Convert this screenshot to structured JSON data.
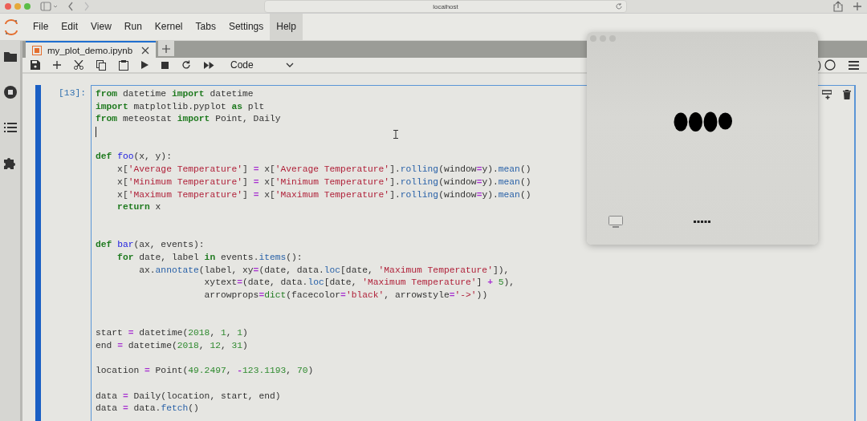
{
  "browser": {
    "address": "localhost"
  },
  "menu": [
    {
      "label": "File",
      "selected": false
    },
    {
      "label": "Edit",
      "selected": false
    },
    {
      "label": "View",
      "selected": false
    },
    {
      "label": "Run",
      "selected": false
    },
    {
      "label": "Kernel",
      "selected": false
    },
    {
      "label": "Tabs",
      "selected": false
    },
    {
      "label": "Settings",
      "selected": false
    },
    {
      "label": "Help",
      "selected": true
    }
  ],
  "tabs": [
    {
      "label": "my_plot_demo.ipynb",
      "selected": true
    }
  ],
  "toolbar": {
    "cell_type": "Code",
    "kernel_status": ")"
  },
  "cell": {
    "prompt": "[13]:",
    "lines": [
      {
        "cursor": false,
        "tokens": [
          {
            "kind": "kw",
            "text": "from"
          },
          {
            "kind": "plain",
            "text": " datetime "
          },
          {
            "kind": "kw",
            "text": "import"
          },
          {
            "kind": "plain",
            "text": " datetime"
          }
        ]
      },
      {
        "cursor": false,
        "tokens": [
          {
            "kind": "kw",
            "text": "import"
          },
          {
            "kind": "plain",
            "text": " matplotlib.pyplot "
          },
          {
            "kind": "kw",
            "text": "as"
          },
          {
            "kind": "plain",
            "text": " plt"
          }
        ]
      },
      {
        "cursor": false,
        "tokens": [
          {
            "kind": "kw",
            "text": "from"
          },
          {
            "kind": "plain",
            "text": " meteostat "
          },
          {
            "kind": "kw",
            "text": "import"
          },
          {
            "kind": "plain",
            "text": " Point, Daily"
          }
        ]
      },
      {
        "cursor": true
      },
      {
        "kind": "blank"
      },
      {
        "cursor": false,
        "tokens": [
          {
            "kind": "kw",
            "text": "def "
          },
          {
            "kind": "def",
            "text": "foo"
          },
          {
            "kind": "plain",
            "text": "(x, y):"
          }
        ]
      },
      {
        "cursor": false,
        "tokens": [
          {
            "kind": "plain",
            "text": "    x["
          },
          {
            "kind": "str",
            "text": "'Average Temperature'"
          },
          {
            "kind": "plain",
            "text": "] "
          },
          {
            "kind": "op",
            "text": "="
          },
          {
            "kind": "plain",
            "text": " x["
          },
          {
            "kind": "str",
            "text": "'Average Temperature'"
          },
          {
            "kind": "plain",
            "text": "]."
          },
          {
            "kind": "prop",
            "text": "rolling"
          },
          {
            "kind": "plain",
            "text": "(window"
          },
          {
            "kind": "op",
            "text": "="
          },
          {
            "kind": "plain",
            "text": "y)."
          },
          {
            "kind": "prop",
            "text": "mean"
          },
          {
            "kind": "plain",
            "text": "()"
          }
        ]
      },
      {
        "cursor": false,
        "tokens": [
          {
            "kind": "plain",
            "text": "    x["
          },
          {
            "kind": "str",
            "text": "'Minimum Temperature'"
          },
          {
            "kind": "plain",
            "text": "] "
          },
          {
            "kind": "op",
            "text": "="
          },
          {
            "kind": "plain",
            "text": " x["
          },
          {
            "kind": "str",
            "text": "'Minimum Temperature'"
          },
          {
            "kind": "plain",
            "text": "]."
          },
          {
            "kind": "prop",
            "text": "rolling"
          },
          {
            "kind": "plain",
            "text": "(window"
          },
          {
            "kind": "op",
            "text": "="
          },
          {
            "kind": "plain",
            "text": "y)."
          },
          {
            "kind": "prop",
            "text": "mean"
          },
          {
            "kind": "plain",
            "text": "()"
          }
        ]
      },
      {
        "cursor": false,
        "tokens": [
          {
            "kind": "plain",
            "text": "    x["
          },
          {
            "kind": "str",
            "text": "'Maximum Temperature'"
          },
          {
            "kind": "plain",
            "text": "] "
          },
          {
            "kind": "op",
            "text": "="
          },
          {
            "kind": "plain",
            "text": " x["
          },
          {
            "kind": "str",
            "text": "'Maximum Temperature'"
          },
          {
            "kind": "plain",
            "text": "]."
          },
          {
            "kind": "prop",
            "text": "rolling"
          },
          {
            "kind": "plain",
            "text": "(window"
          },
          {
            "kind": "op",
            "text": "="
          },
          {
            "kind": "plain",
            "text": "y)."
          },
          {
            "kind": "prop",
            "text": "mean"
          },
          {
            "kind": "plain",
            "text": "()"
          }
        ]
      },
      {
        "cursor": false,
        "tokens": [
          {
            "kind": "kw",
            "text": "    return"
          },
          {
            "kind": "plain",
            "text": " x"
          }
        ]
      },
      {
        "kind": "blank"
      },
      {
        "kind": "blank"
      },
      {
        "cursor": false,
        "tokens": [
          {
            "kind": "kw",
            "text": "def "
          },
          {
            "kind": "def",
            "text": "bar"
          },
          {
            "kind": "plain",
            "text": "(ax, events):"
          }
        ]
      },
      {
        "cursor": false,
        "tokens": [
          {
            "kind": "kw",
            "text": "    for"
          },
          {
            "kind": "plain",
            "text": " date, label "
          },
          {
            "kind": "kw",
            "text": "in"
          },
          {
            "kind": "plain",
            "text": " events."
          },
          {
            "kind": "prop",
            "text": "items"
          },
          {
            "kind": "plain",
            "text": "():"
          }
        ]
      },
      {
        "cursor": false,
        "tokens": [
          {
            "kind": "plain",
            "text": "        ax."
          },
          {
            "kind": "prop",
            "text": "annotate"
          },
          {
            "kind": "plain",
            "text": "(label, xy"
          },
          {
            "kind": "op",
            "text": "="
          },
          {
            "kind": "plain",
            "text": "(date, data."
          },
          {
            "kind": "prop",
            "text": "loc"
          },
          {
            "kind": "plain",
            "text": "[date, "
          },
          {
            "kind": "str",
            "text": "'Maximum Temperature'"
          },
          {
            "kind": "plain",
            "text": "]),"
          }
        ]
      },
      {
        "cursor": false,
        "tokens": [
          {
            "kind": "plain",
            "text": "                    xytext"
          },
          {
            "kind": "op",
            "text": "="
          },
          {
            "kind": "plain",
            "text": "(date, data."
          },
          {
            "kind": "prop",
            "text": "loc"
          },
          {
            "kind": "plain",
            "text": "[date, "
          },
          {
            "kind": "str",
            "text": "'Maximum Temperature'"
          },
          {
            "kind": "plain",
            "text": "] "
          },
          {
            "kind": "op",
            "text": "+"
          },
          {
            "kind": "num",
            "text": " 5"
          },
          {
            "kind": "plain",
            "text": "),"
          }
        ]
      },
      {
        "cursor": false,
        "tokens": [
          {
            "kind": "plain",
            "text": "                    arrowprops"
          },
          {
            "kind": "op",
            "text": "="
          },
          {
            "kind": "builtin",
            "text": "dict"
          },
          {
            "kind": "plain",
            "text": "(facecolor"
          },
          {
            "kind": "op",
            "text": "="
          },
          {
            "kind": "str",
            "text": "'black'"
          },
          {
            "kind": "plain",
            "text": ", arrowstyle"
          },
          {
            "kind": "op",
            "text": "="
          },
          {
            "kind": "str",
            "text": "'->'"
          },
          {
            "kind": "plain",
            "text": "))"
          }
        ]
      },
      {
        "kind": "blank"
      },
      {
        "kind": "blank"
      },
      {
        "cursor": false,
        "tokens": [
          {
            "kind": "plain",
            "text": "start "
          },
          {
            "kind": "op",
            "text": "="
          },
          {
            "kind": "plain",
            "text": " datetime("
          },
          {
            "kind": "num",
            "text": "2018"
          },
          {
            "kind": "plain",
            "text": ", "
          },
          {
            "kind": "num",
            "text": "1"
          },
          {
            "kind": "plain",
            "text": ", "
          },
          {
            "kind": "num",
            "text": "1"
          },
          {
            "kind": "plain",
            "text": ")"
          }
        ]
      },
      {
        "cursor": false,
        "tokens": [
          {
            "kind": "plain",
            "text": "end "
          },
          {
            "kind": "op",
            "text": "="
          },
          {
            "kind": "plain",
            "text": " datetime("
          },
          {
            "kind": "num",
            "text": "2018"
          },
          {
            "kind": "plain",
            "text": ", "
          },
          {
            "kind": "num",
            "text": "12"
          },
          {
            "kind": "plain",
            "text": ", "
          },
          {
            "kind": "num",
            "text": "31"
          },
          {
            "kind": "plain",
            "text": ")"
          }
        ]
      },
      {
        "kind": "blank"
      },
      {
        "cursor": false,
        "tokens": [
          {
            "kind": "plain",
            "text": "location "
          },
          {
            "kind": "op",
            "text": "="
          },
          {
            "kind": "plain",
            "text": " Point("
          },
          {
            "kind": "num",
            "text": "49.2497"
          },
          {
            "kind": "plain",
            "text": ", "
          },
          {
            "kind": "op",
            "text": "-"
          },
          {
            "kind": "num",
            "text": "123.1193"
          },
          {
            "kind": "plain",
            "text": ", "
          },
          {
            "kind": "num",
            "text": "70"
          },
          {
            "kind": "plain",
            "text": ")"
          }
        ]
      },
      {
        "kind": "blank"
      },
      {
        "cursor": false,
        "tokens": [
          {
            "kind": "plain",
            "text": "data "
          },
          {
            "kind": "op",
            "text": "="
          },
          {
            "kind": "plain",
            "text": " Daily(location, start, end)"
          }
        ]
      },
      {
        "cursor": false,
        "tokens": [
          {
            "kind": "plain",
            "text": "data "
          },
          {
            "kind": "op",
            "text": "="
          },
          {
            "kind": "plain",
            "text": " data."
          },
          {
            "kind": "prop",
            "text": "fetch"
          },
          {
            "kind": "plain",
            "text": "()"
          }
        ]
      }
    ]
  }
}
